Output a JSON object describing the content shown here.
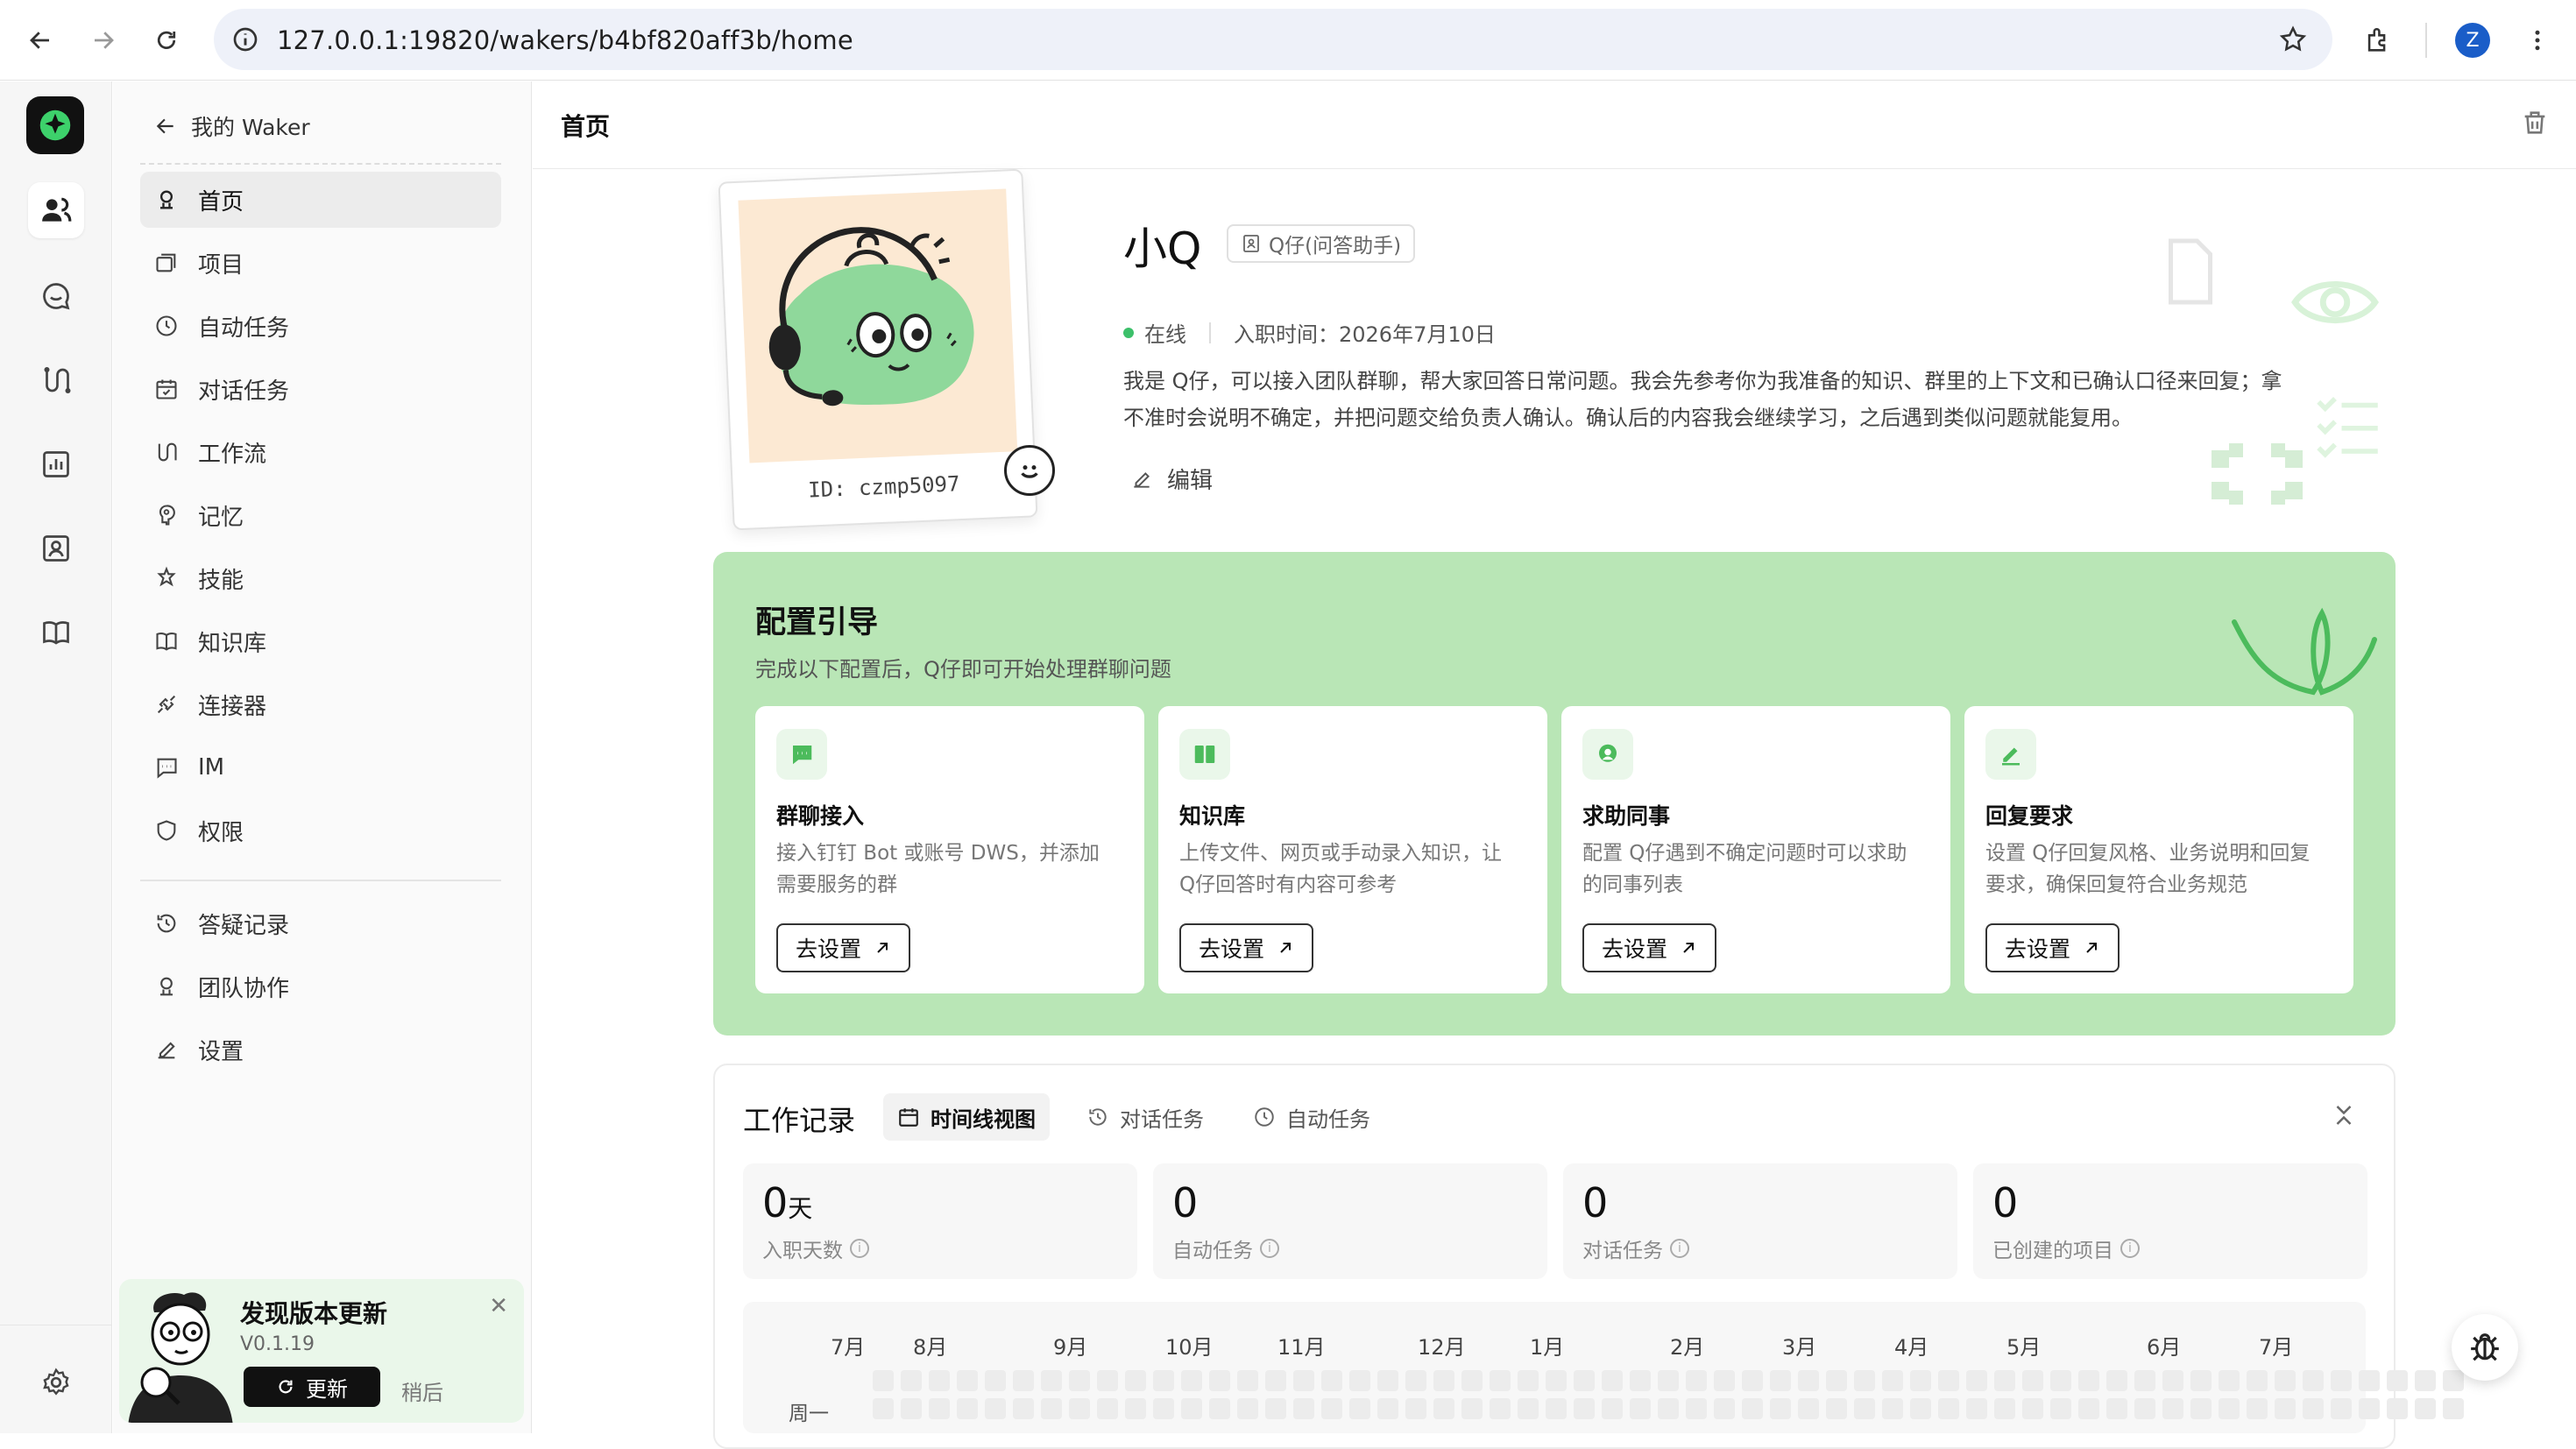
{
  "browser": {
    "url": "127.0.0.1:19820/wakers/b4bf820aff3b/home",
    "profile_initial": "Z",
    "colors": {
      "profile": "#1a5dc8"
    }
  },
  "rail": {
    "items": [
      "people-icon",
      "chat-icon",
      "workflow-icon",
      "chart-icon",
      "contact-icon",
      "book-icon"
    ],
    "settings_icon": "gear-icon"
  },
  "sidebar": {
    "back_label": "我的 Waker",
    "items": [
      {
        "label": "首页",
        "icon": "home-icon",
        "active": true
      },
      {
        "label": "项目",
        "icon": "folder-icon"
      },
      {
        "label": "自动任务",
        "icon": "clock-icon"
      },
      {
        "label": "对话任务",
        "icon": "calendar-icon"
      },
      {
        "label": "工作流",
        "icon": "workflow-icon"
      },
      {
        "label": "记忆",
        "icon": "memory-icon"
      },
      {
        "label": "技能",
        "icon": "skill-icon"
      },
      {
        "label": "知识库",
        "icon": "book-icon"
      },
      {
        "label": "连接器",
        "icon": "connector-icon"
      },
      {
        "label": "IM",
        "icon": "im-icon"
      },
      {
        "label": "权限",
        "icon": "shield-icon"
      }
    ],
    "secondary": [
      {
        "label": "答疑记录",
        "icon": "history-icon"
      },
      {
        "label": "团队协作",
        "icon": "team-icon"
      },
      {
        "label": "设置",
        "icon": "edit-icon"
      }
    ]
  },
  "update": {
    "title": "发现版本更新",
    "version": "V0.1.19",
    "update_label": "更新",
    "later_label": "稍后"
  },
  "page": {
    "title": "首页"
  },
  "profile": {
    "name": "小Q",
    "role_tag": "Q仔(问答助手)",
    "status": "在线",
    "join_date": "入职时间：2026年7月10日",
    "id_label": "ID: czmp5097",
    "description_line1": "我是 Q仔，可以接入团队群聊，帮大家回答日常问题。我会先参考你为我准备的知识、群里的上下文和已确认口径来回复；拿",
    "description_line2": "不准时会说明不确定，并把问题交给负责人确认。确认后的内容我会继续学习，之后遇到类似问题就能复用。",
    "edit_label": "编辑"
  },
  "guide": {
    "title": "配置引导",
    "subtitle": "完成以下配置后，Q仔即可开始处理群聊问题",
    "cards": [
      {
        "title": "群聊接入",
        "desc1": "接入钉钉 Bot 或账号 DWS，并添加",
        "desc2": "需要服务的群",
        "button": "去设置",
        "icon": "message-icon"
      },
      {
        "title": "知识库",
        "desc1": "上传文件、网页或手动录入知识，让",
        "desc2": "Q仔回答时有内容可参考",
        "button": "去设置",
        "icon": "book-icon"
      },
      {
        "title": "求助同事",
        "desc1": "配置 Q仔遇到不确定问题时可以求助",
        "desc2": "的同事列表",
        "button": "去设置",
        "icon": "person-icon"
      },
      {
        "title": "回复要求",
        "desc1": "设置 Q仔回复风格、业务说明和回复",
        "desc2": "要求，确保回复符合业务规范",
        "button": "去设置",
        "icon": "pen-icon"
      }
    ],
    "colors": {
      "bg": "#b9e6b6",
      "accent": "#4cbb5c"
    }
  },
  "work": {
    "title": "工作记录",
    "tabs": [
      "时间线视图",
      "对话任务",
      "自动任务"
    ],
    "stats": [
      {
        "value": "0",
        "unit": "天",
        "label": "入职天数"
      },
      {
        "value": "0",
        "unit": "",
        "label": "自动任务"
      },
      {
        "value": "0",
        "unit": "",
        "label": "对话任务"
      },
      {
        "value": "0",
        "unit": "",
        "label": "已创建的项目"
      }
    ],
    "months": [
      "7月",
      "8月",
      "9月",
      "10月",
      "11月",
      "12月",
      "1月",
      "2月",
      "3月",
      "4月",
      "5月",
      "6月",
      "7月"
    ],
    "weekday": "周一"
  }
}
